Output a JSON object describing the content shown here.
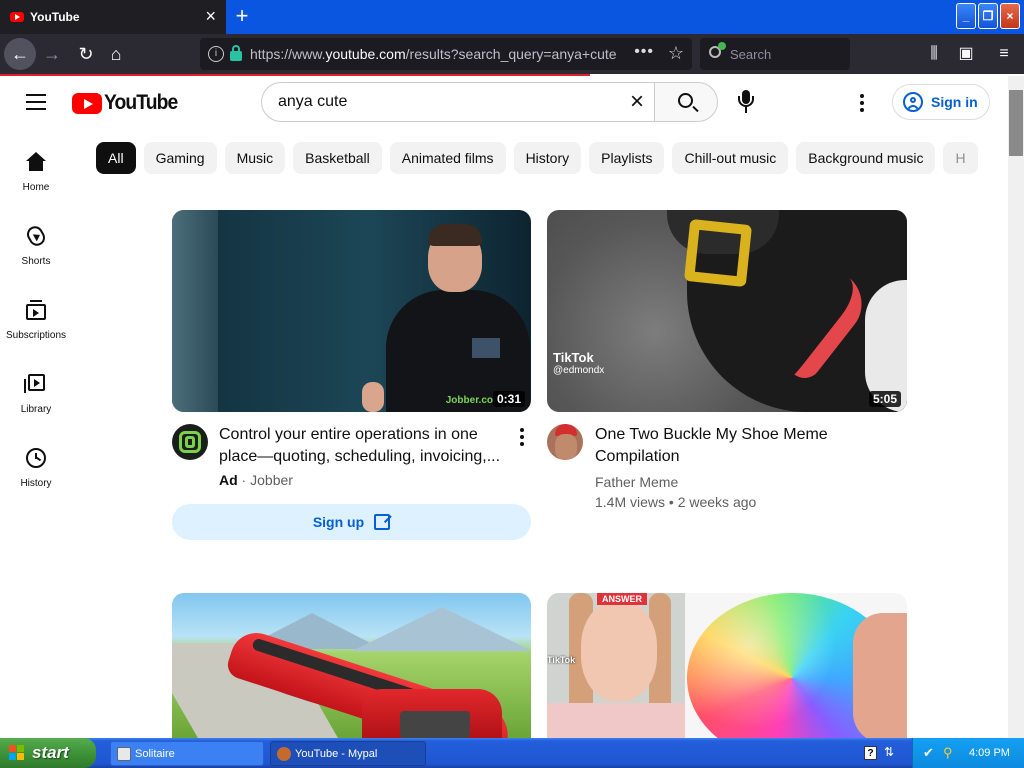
{
  "browser": {
    "tab_title": "YouTube",
    "tab_close": "×",
    "new_tab": "+",
    "url_prefix": "https://www.",
    "url_host": "youtube.com",
    "url_path": "/results?search_query=anya+cute",
    "search_placeholder": "Search",
    "window_controls": {
      "minimize": "_",
      "restore": "❐",
      "close": "×"
    }
  },
  "masthead": {
    "logo_text": "YouTube",
    "search_value": "anya cute",
    "signin_label": "Sign in"
  },
  "guide": {
    "items": [
      {
        "label": "Home",
        "icon": "home-icon"
      },
      {
        "label": "Shorts",
        "icon": "shorts-icon"
      },
      {
        "label": "Subscriptions",
        "icon": "subscriptions-icon"
      },
      {
        "label": "Library",
        "icon": "library-icon"
      },
      {
        "label": "History",
        "icon": "history-icon"
      }
    ]
  },
  "chips": [
    "All",
    "Gaming",
    "Music",
    "Basketball",
    "Animated films",
    "History",
    "Playlists",
    "Chill-out music",
    "Background music",
    "H"
  ],
  "videos": [
    {
      "title": "Control your entire operations in one place—quoting, scheduling, invoicing,...",
      "ad_badge": "Ad",
      "channel": "Jobber",
      "duration": "0:31",
      "brand_watermark": "Jobber.co",
      "cta": "Sign up"
    },
    {
      "title": "One Two Buckle My Shoe Meme Compilation",
      "channel": "Father Meme",
      "meta": "1.4M views • 2 weeks ago",
      "duration": "5:05",
      "watermark": "TikTok",
      "watermark_user": "@edmondx"
    },
    {
      "title": "",
      "channel": ""
    },
    {
      "title": "",
      "channel": "",
      "overlay_badge": "ANSWER",
      "watermark": "TikTok"
    }
  ],
  "taskbar": {
    "start_label": "start",
    "items": [
      {
        "label": "Solitaire"
      },
      {
        "label": "YouTube - Mypal"
      }
    ],
    "clock": "4:09 PM"
  },
  "colors": {
    "brand_red": "#ff0000",
    "link_blue": "#065fd4",
    "chip_active": "#0f0f0f",
    "firefox_dark": "#2b2a33",
    "xp_taskbar": "#245edb"
  }
}
